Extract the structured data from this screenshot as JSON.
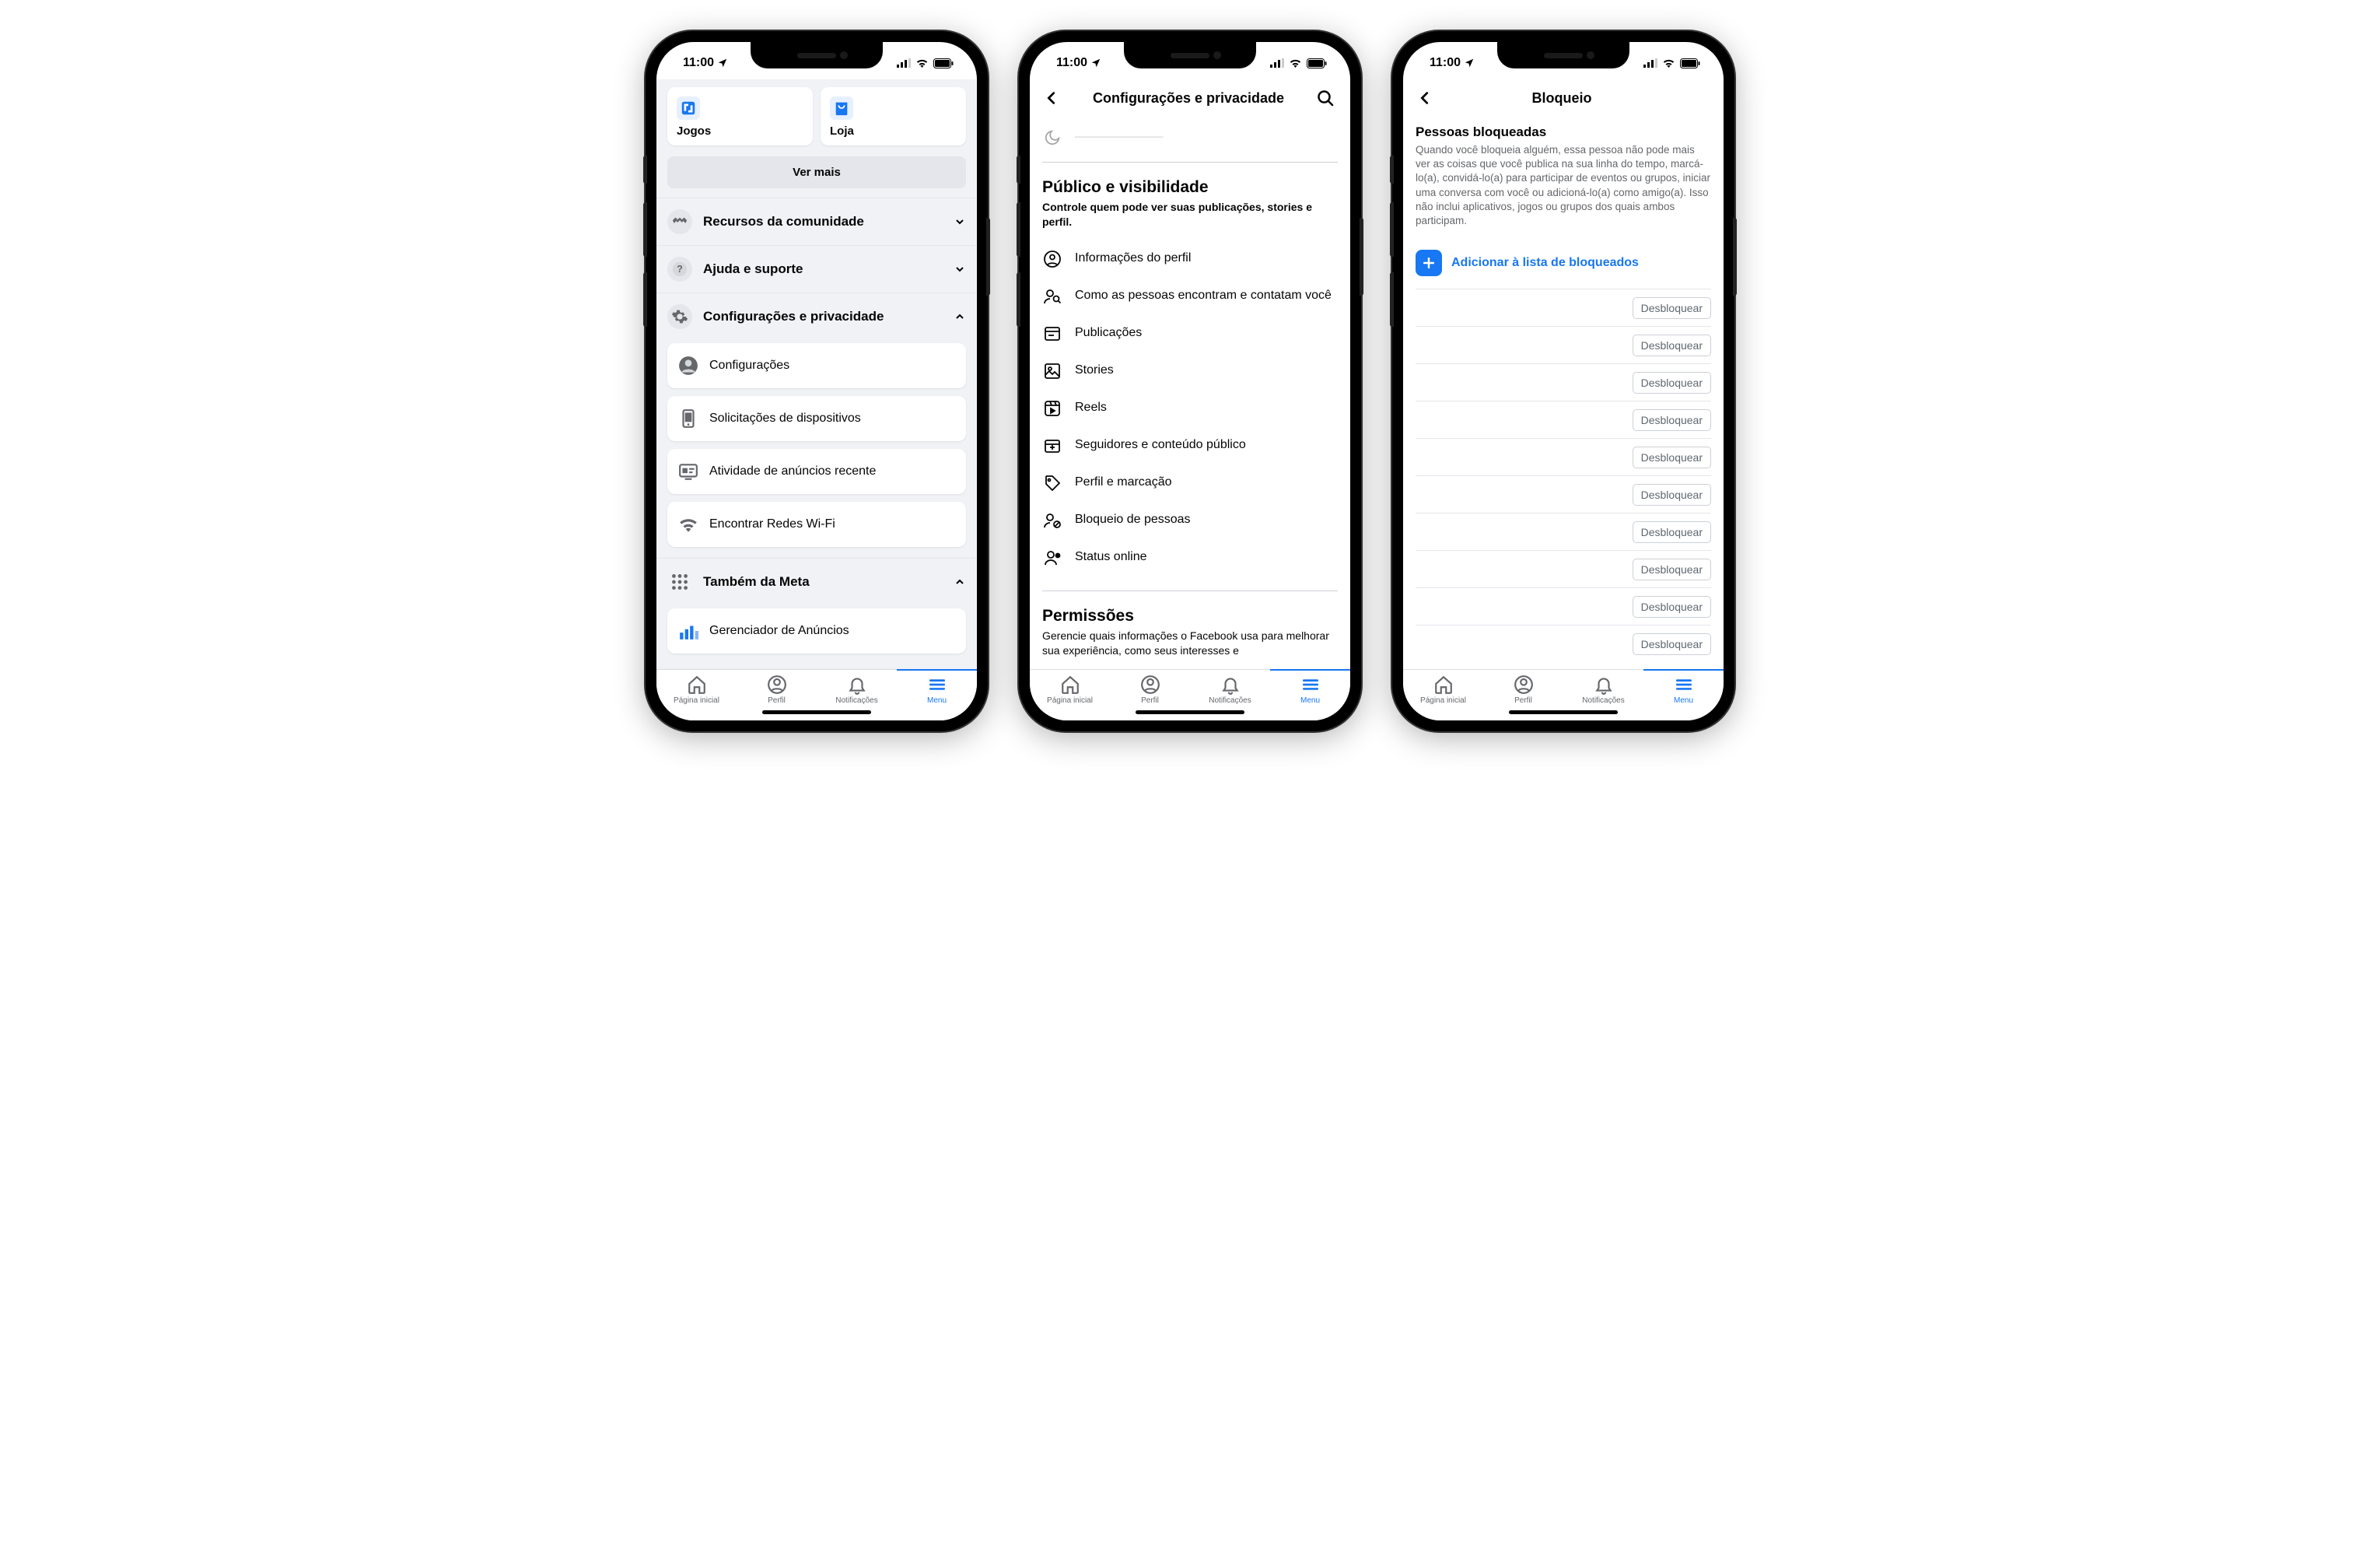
{
  "status": {
    "time": "11:00"
  },
  "tabbar": {
    "home": "Página inicial",
    "profile": "Perfil",
    "notifications": "Notificações",
    "menu": "Menu"
  },
  "screen1": {
    "shortcuts": {
      "games": "Jogos",
      "store": "Loja"
    },
    "ver_mais": "Ver mais",
    "exp": {
      "community": "Recursos da comunidade",
      "help": "Ajuda e suporte",
      "settings_privacy": "Configurações e privacidade",
      "also_meta": "Também da Meta"
    },
    "settings_items": {
      "settings": "Configurações",
      "device_requests": "Solicitações de dispositivos",
      "ad_activity": "Atividade de anúncios recente",
      "wifi": "Encontrar Redes Wi-Fi"
    },
    "meta_items": {
      "ads_manager": "Gerenciador de Anúncios"
    }
  },
  "screen2": {
    "header_title": "Configurações e privacidade",
    "partial_item": "Modo escuro",
    "section1": {
      "title": "Público e visibilidade",
      "subtitle": "Controle quem pode ver suas publicações, stories e perfil.",
      "items": {
        "profile_info": "Informações do perfil",
        "find_contact": "Como as pessoas encontram e contatam você",
        "posts": "Publicações",
        "stories": "Stories",
        "reels": "Reels",
        "followers": "Seguidores e conteúdo público",
        "tagging": "Perfil e marcação",
        "blocking": "Bloqueio de pessoas",
        "online": "Status online"
      }
    },
    "section2": {
      "title": "Permissões",
      "subtitle": "Gerencie quais informações o Facebook usa para melhorar sua experiência, como seus interesses e"
    }
  },
  "screen3": {
    "header_title": "Bloqueio",
    "section_title": "Pessoas bloqueadas",
    "description": "Quando você bloqueia alguém, essa pessoa não pode mais ver as coisas que você publica na sua linha do tempo, marcá-lo(a), convidá-lo(a) para participar de eventos ou grupos, iniciar uma conversa com você ou adicioná-lo(a) como amigo(a). Isso não inclui aplicativos, jogos ou grupos dos quais ambos participam.",
    "add_label": "Adicionar à lista de bloqueados",
    "unblock_label": "Desbloquear",
    "count": 10
  }
}
